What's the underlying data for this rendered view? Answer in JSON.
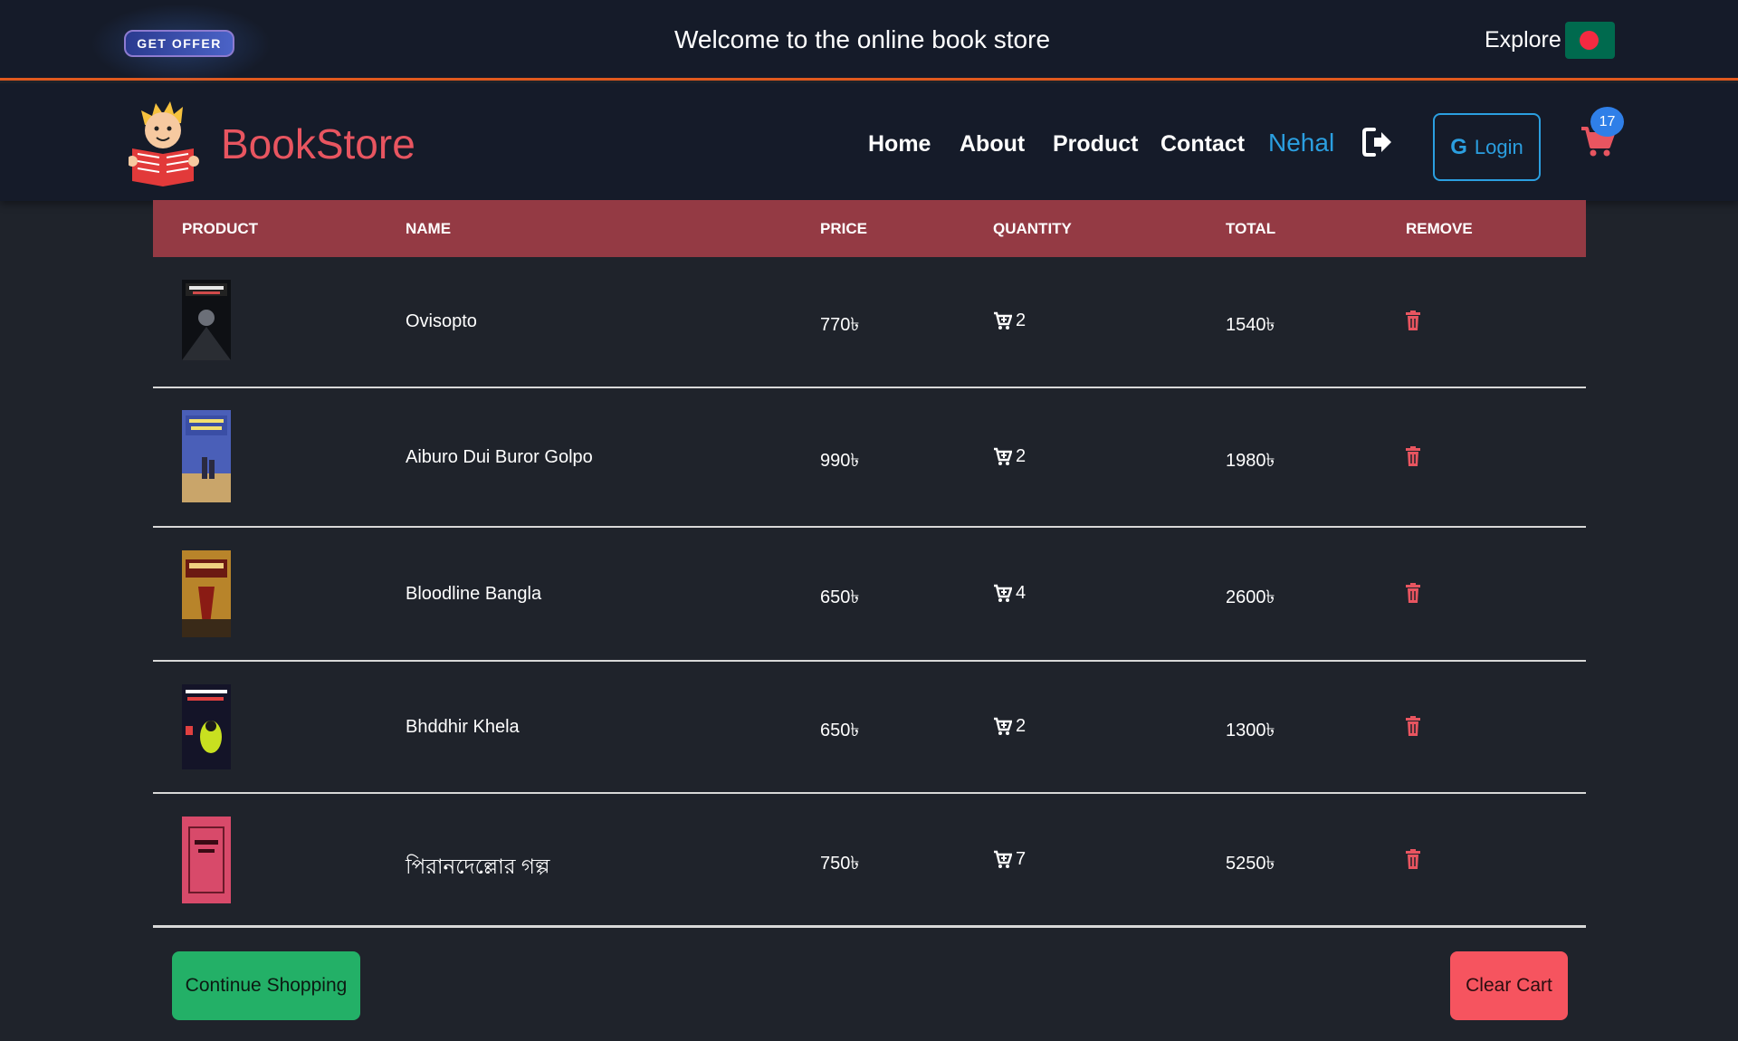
{
  "topbar": {
    "offer_label": "GET OFFER",
    "welcome": "Welcome to the online book store",
    "explore": "Explore",
    "flag_icon": "bangladesh-flag-icon"
  },
  "nav": {
    "brand": "BookStore",
    "links": [
      "Home",
      "About",
      "Product",
      "Contact"
    ],
    "user": "Nehal",
    "login_label": "Login",
    "login_g": "G",
    "cart_count": "17",
    "accent": "#2b9fe0",
    "brand_color": "#e85560"
  },
  "table": {
    "headers": [
      "PRODUCT",
      "NAME",
      "PRICE",
      "QUANTITY",
      "TOTAL",
      "REMOVE"
    ],
    "header_color": "#943a44",
    "rows": [
      {
        "name": "Ovisopto",
        "price": "770৳",
        "quantity": "2",
        "total": "1540৳"
      },
      {
        "name": "Aiburo Dui Buror Golpo",
        "price": "990৳",
        "quantity": "2",
        "total": "1980৳"
      },
      {
        "name": "Bloodline Bangla",
        "price": "650৳",
        "quantity": "4",
        "total": "2600৳"
      },
      {
        "name": "Bhddhir Khela",
        "price": "650৳",
        "quantity": "2",
        "total": "1300৳"
      },
      {
        "name": "পিরানদেল্লোর গল্প",
        "price": "750৳",
        "quantity": "7",
        "total": "5250৳"
      }
    ]
  },
  "actions": {
    "continue_label": "Continue Shopping",
    "clear_label": "Clear Cart"
  }
}
